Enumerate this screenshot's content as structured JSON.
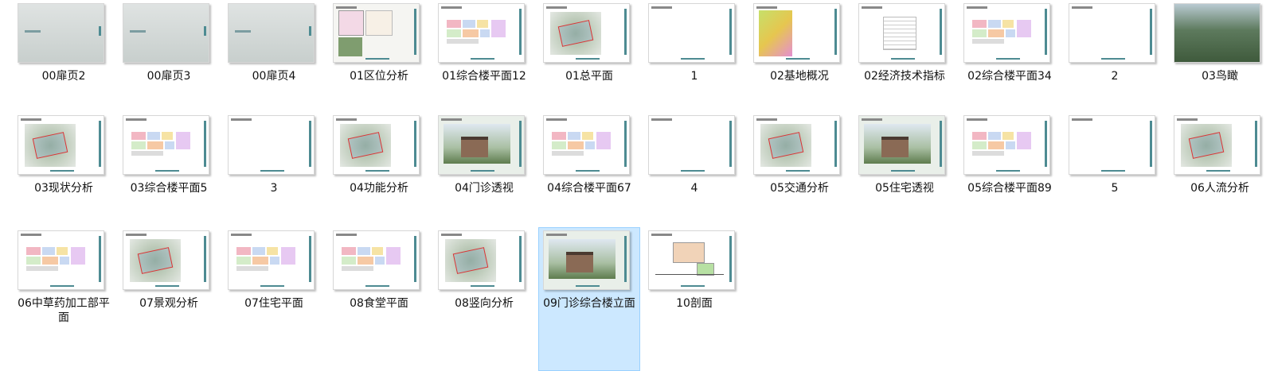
{
  "window": {
    "view": "large-icons"
  },
  "files": [
    {
      "name": "00扉页2",
      "thumb": "cover"
    },
    {
      "name": "00扉页3",
      "thumb": "cover"
    },
    {
      "name": "00扉页4",
      "thumb": "cover"
    },
    {
      "name": "01区位分析",
      "thumb": "map"
    },
    {
      "name": "01综合楼平面12",
      "thumb": "plan"
    },
    {
      "name": "01总平面",
      "thumb": "site"
    },
    {
      "name": "1",
      "thumb": "text"
    },
    {
      "name": "02基地概况",
      "thumb": "map2"
    },
    {
      "name": "02经济技术指标",
      "thumb": "table"
    },
    {
      "name": "02综合楼平面34",
      "thumb": "plan"
    },
    {
      "name": "2",
      "thumb": "text"
    },
    {
      "name": "03鸟瞰",
      "thumb": "aerial"
    },
    {
      "name": "03现状分析",
      "thumb": "site2"
    },
    {
      "name": "03综合楼平面5",
      "thumb": "plan"
    },
    {
      "name": "3",
      "thumb": "text"
    },
    {
      "name": "04功能分析",
      "thumb": "site"
    },
    {
      "name": "04门诊透视",
      "thumb": "photo"
    },
    {
      "name": "04综合楼平面67",
      "thumb": "plan"
    },
    {
      "name": "4",
      "thumb": "text"
    },
    {
      "name": "05交通分析",
      "thumb": "site"
    },
    {
      "name": "05住宅透视",
      "thumb": "photo"
    },
    {
      "name": "05综合楼平面89",
      "thumb": "plan"
    },
    {
      "name": "5",
      "thumb": "text"
    },
    {
      "name": "06人流分析",
      "thumb": "site"
    },
    {
      "name": "06中草药加工部平面",
      "thumb": "plan"
    },
    {
      "name": "07景观分析",
      "thumb": "site"
    },
    {
      "name": "07住宅平面",
      "thumb": "plan"
    },
    {
      "name": "08食堂平面",
      "thumb": "plan"
    },
    {
      "name": "08竖向分析",
      "thumb": "site"
    },
    {
      "name": "09门诊综合楼立面",
      "thumb": "photo",
      "selected": true
    },
    {
      "name": "10剖面",
      "thumb": "section"
    }
  ],
  "colors": {
    "accent": "#4d8b92",
    "selection_bg": "#cce8ff",
    "selection_border": "#99d1ff"
  }
}
